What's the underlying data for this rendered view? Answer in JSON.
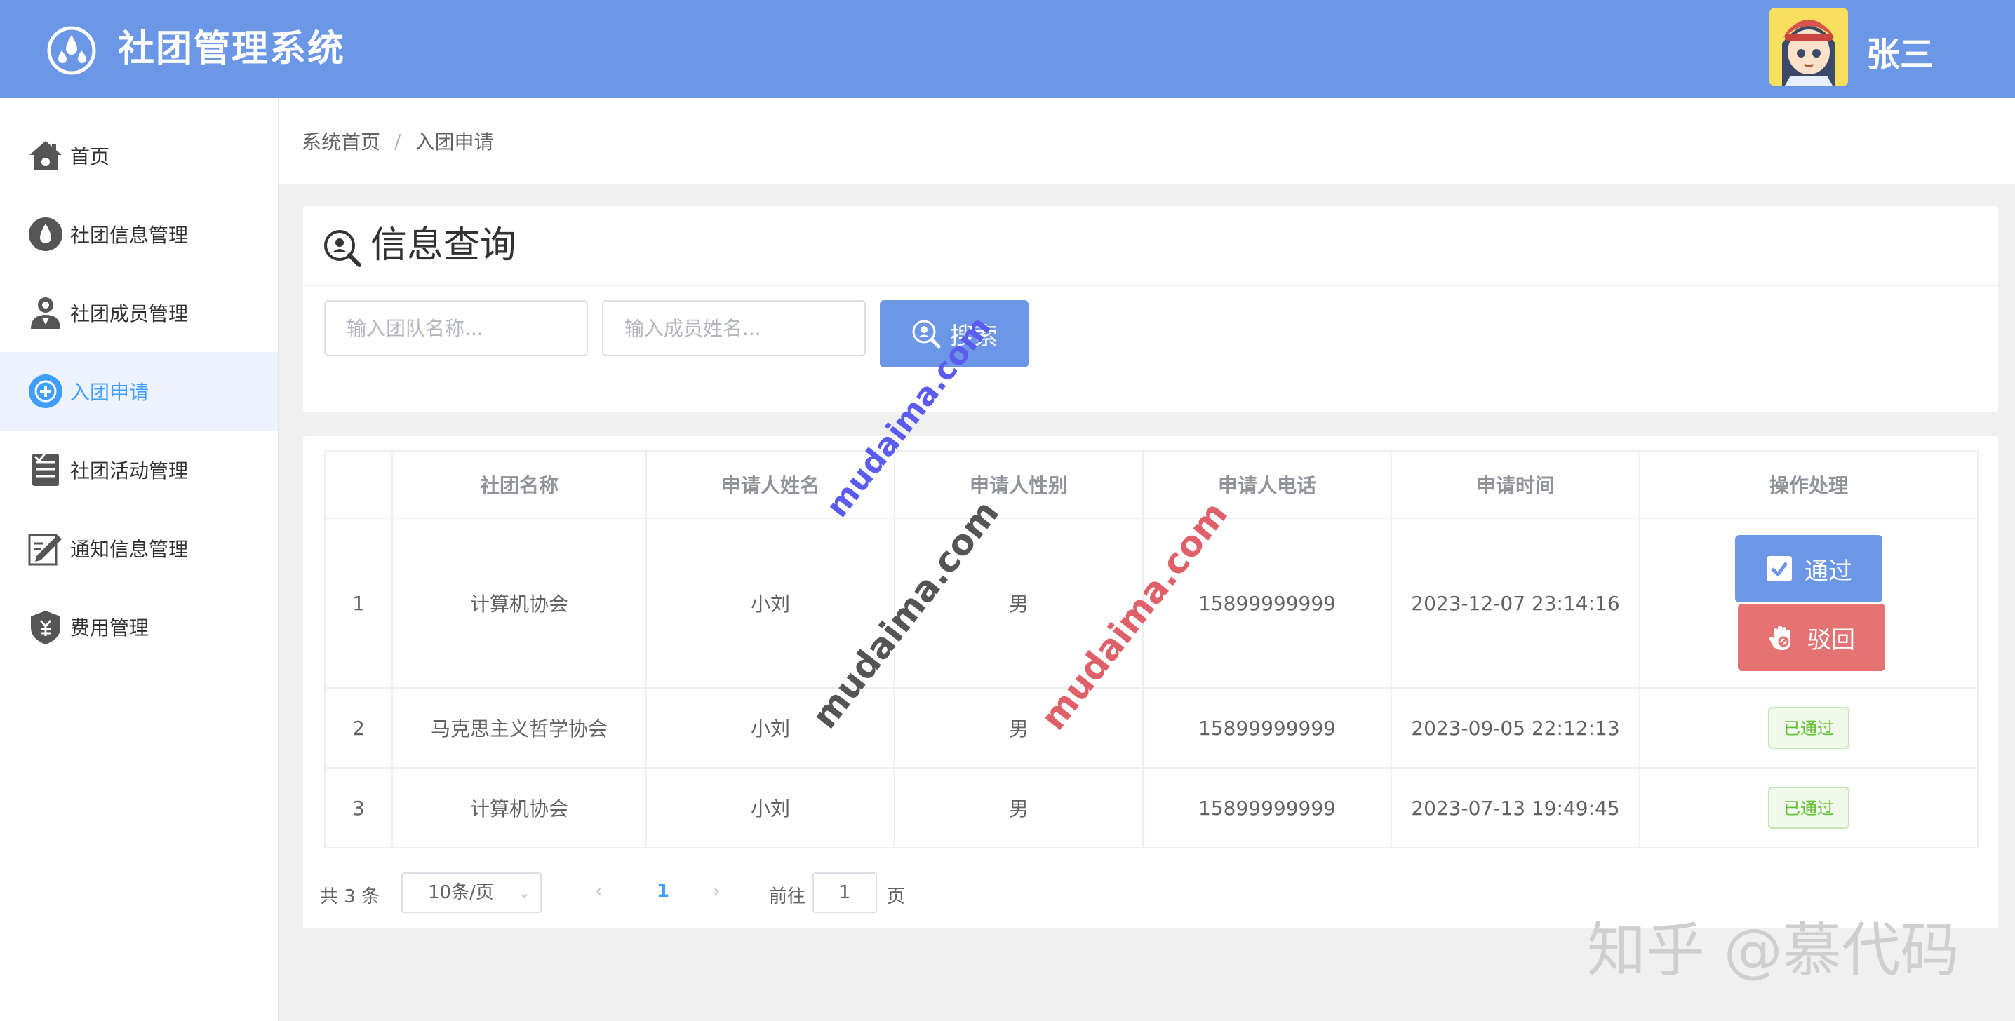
{
  "header": {
    "app_title": "社团管理系统",
    "username": "张三",
    "brand_color": "#6c96e6"
  },
  "sidebar": {
    "items": [
      {
        "label": "首页",
        "icon": "home-icon"
      },
      {
        "label": "社团信息管理",
        "icon": "water-drop-icon"
      },
      {
        "label": "社团成员管理",
        "icon": "user-icon"
      },
      {
        "label": "入团申请",
        "icon": "plus-circle-icon",
        "active": true
      },
      {
        "label": "社团活动管理",
        "icon": "document-list-icon"
      },
      {
        "label": "通知信息管理",
        "icon": "edit-note-icon"
      },
      {
        "label": "费用管理",
        "icon": "shield-money-icon"
      }
    ]
  },
  "breadcrumb": {
    "home": "系统首页",
    "sep": "/",
    "current": "入团申请"
  },
  "search": {
    "title": "信息查询",
    "team_placeholder": "输入团队名称...",
    "member_placeholder": "输入成员姓名...",
    "button_label": "搜索"
  },
  "table": {
    "headers": [
      "",
      "社团名称",
      "申请人姓名",
      "申请人性别",
      "申请人电话",
      "申请时间",
      "操作处理"
    ],
    "rows": [
      {
        "idx": "1",
        "club": "计算机协会",
        "name": "小刘",
        "gender": "男",
        "phone": "15899999999",
        "time": "2023-12-07 23:14:16",
        "status": "pending"
      },
      {
        "idx": "2",
        "club": "马克思主义哲学协会",
        "name": "小刘",
        "gender": "男",
        "phone": "15899999999",
        "time": "2023-09-05 22:12:13",
        "status": "已通过"
      },
      {
        "idx": "3",
        "club": "计算机协会",
        "name": "小刘",
        "gender": "男",
        "phone": "15899999999",
        "time": "2023-07-13 19:49:45",
        "status": "已通过"
      }
    ],
    "pass_label": "通过",
    "reject_label": "驳回"
  },
  "pagination": {
    "total": "共 3 条",
    "page_size": "10条/页",
    "current_page": "1",
    "goto_label": "前往",
    "goto_value": "1",
    "page_label": "页"
  },
  "watermarks": {
    "site": "mudaima.com",
    "corner": "知乎 @慕代码"
  }
}
